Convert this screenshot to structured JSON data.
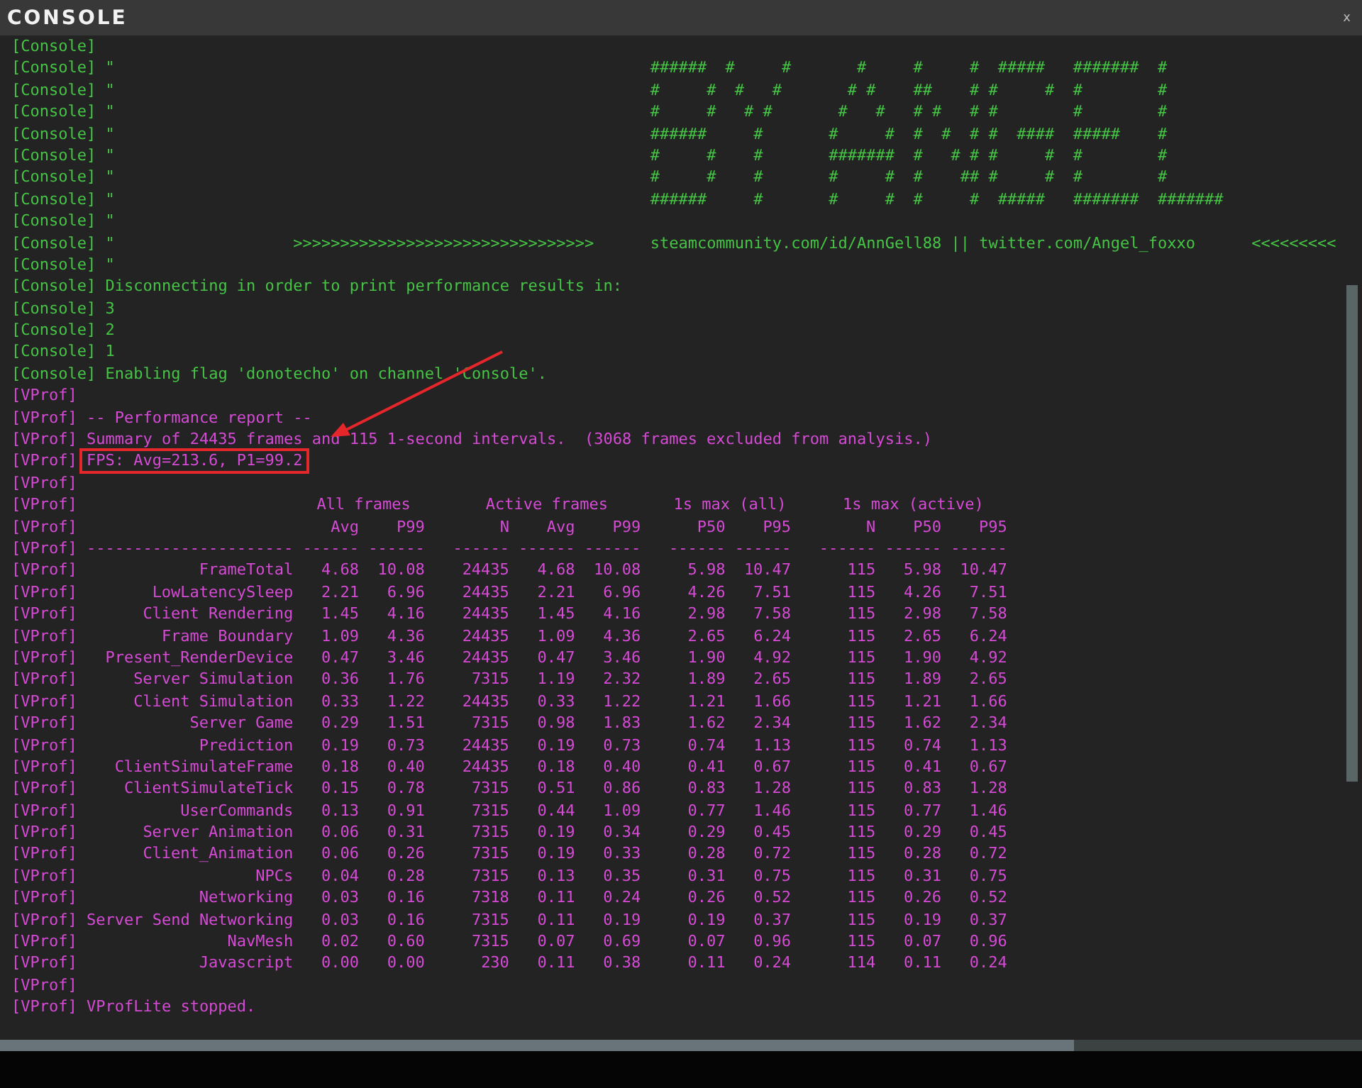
{
  "window": {
    "title": "CONSOLE",
    "close": "x"
  },
  "lines": [
    {
      "channel": "[Console]",
      "kind": "console"
    },
    {
      "channel": "[Console]",
      "kind": "console",
      "text": "\"                                                         ######  #     #       #     #     #  #####   #######  #",
      "highlighted": false
    },
    {
      "channel": "[Console]",
      "kind": "console",
      "text": "\"                                                         #     #  #   #       # #    ##    # #     #  #        #",
      "highlighted": false
    },
    {
      "channel": "[Console]",
      "kind": "console",
      "text": "\"                                                         #     #   # #       #   #   # #   # #        #        #",
      "highlighted": false
    },
    {
      "channel": "[Console]",
      "kind": "console",
      "text": "\"                                                         ######     #       #     #  #  #  # #  ####  #####    #",
      "highlighted": false
    },
    {
      "channel": "[Console]",
      "kind": "console",
      "text": "\"                                                         #     #    #       #######  #   # # #     #  #        #",
      "highlighted": false
    },
    {
      "channel": "[Console]",
      "kind": "console",
      "text": "\"                                                         #     #    #       #     #  #    ## #     #  #        #",
      "highlighted": false
    },
    {
      "channel": "[Console]",
      "kind": "console",
      "text": "\"                                                         ######     #       #     #  #     #  #####   #######  #######",
      "highlighted": false
    },
    {
      "channel": "[Console]",
      "kind": "console",
      "text": "\"",
      "highlighted": false
    },
    {
      "channel": "[Console]",
      "kind": "console",
      "text": "\"                   >>>>>>>>>>>>>>>>>>>>>>>>>>>>>>>>      steamcommunity.com/id/AnnGell88 || twitter.com/Angel_foxxo      <<<<<<<<<",
      "highlighted": false
    },
    {
      "channel": "[Console]",
      "kind": "console",
      "text": "\"",
      "highlighted": false
    },
    {
      "channel": "[Console]",
      "kind": "console",
      "text": "Disconnecting in order to print performance results in:",
      "highlighted": false
    },
    {
      "channel": "[Console]",
      "kind": "console",
      "text": "3",
      "highlighted": false
    },
    {
      "channel": "[Console]",
      "kind": "console",
      "text": "2",
      "highlighted": false
    },
    {
      "channel": "[Console]",
      "kind": "console",
      "text": "1",
      "highlighted": false
    },
    {
      "channel": "[Console]",
      "kind": "console",
      "text": "Enabling flag 'donotecho' on channel 'Console'.",
      "highlighted": false
    },
    {
      "channel": "[VProf]",
      "kind": "vprof"
    },
    {
      "channel": "[VProf]",
      "kind": "vprof",
      "text": "-- Performance report --",
      "highlighted": false
    },
    {
      "channel": "[VProf]",
      "kind": "vprof",
      "text": "Summary of 24435 frames and 115 1-second intervals.  (3068 frames excluded from analysis.)",
      "highlighted": false
    },
    {
      "channel": "[VProf]",
      "kind": "vprof",
      "text": "FPS: Avg=213.6, P1=99.2",
      "highlighted": true
    },
    {
      "channel": "[VProf]",
      "kind": "vprof"
    },
    {
      "channel": "[VProf]",
      "kind": "vprof",
      "groups": [
        "All frames",
        "Active frames",
        "1s max (all)",
        "1s max (active)"
      ]
    },
    {
      "channel": "[VProf]",
      "kind": "vprof",
      "columns": [
        "Avg",
        "P99",
        "N",
        "Avg",
        "P99",
        "P50",
        "P95",
        "N",
        "P50",
        "P95"
      ]
    },
    {
      "channel": "[VProf]",
      "kind": "vprof",
      "cells": [
        "----------------------",
        "------",
        "------",
        "------",
        "------",
        "------",
        "------",
        "------",
        "------",
        "------",
        "------"
      ]
    },
    {
      "channel": "[VProf]",
      "kind": "vprof",
      "cells": [
        "FrameTotal",
        "4.68",
        "10.08",
        "24435",
        "4.68",
        "10.08",
        "5.98",
        "10.47",
        "115",
        "5.98",
        "10.47"
      ]
    },
    {
      "channel": "[VProf]",
      "kind": "vprof",
      "cells": [
        "LowLatencySleep",
        "2.21",
        "6.96",
        "24435",
        "2.21",
        "6.96",
        "4.26",
        "7.51",
        "115",
        "4.26",
        "7.51"
      ]
    },
    {
      "channel": "[VProf]",
      "kind": "vprof",
      "cells": [
        "Client Rendering",
        "1.45",
        "4.16",
        "24435",
        "1.45",
        "4.16",
        "2.98",
        "7.58",
        "115",
        "2.98",
        "7.58"
      ]
    },
    {
      "channel": "[VProf]",
      "kind": "vprof",
      "cells": [
        "Frame Boundary",
        "1.09",
        "4.36",
        "24435",
        "1.09",
        "4.36",
        "2.65",
        "6.24",
        "115",
        "2.65",
        "6.24"
      ]
    },
    {
      "channel": "[VProf]",
      "kind": "vprof",
      "cells": [
        "Present_RenderDevice",
        "0.47",
        "3.46",
        "24435",
        "0.47",
        "3.46",
        "1.90",
        "4.92",
        "115",
        "1.90",
        "4.92"
      ]
    },
    {
      "channel": "[VProf]",
      "kind": "vprof",
      "cells": [
        "Server Simulation",
        "0.36",
        "1.76",
        "7315",
        "1.19",
        "2.32",
        "1.89",
        "2.65",
        "115",
        "1.89",
        "2.65"
      ]
    },
    {
      "channel": "[VProf]",
      "kind": "vprof",
      "cells": [
        "Client Simulation",
        "0.33",
        "1.22",
        "24435",
        "0.33",
        "1.22",
        "1.21",
        "1.66",
        "115",
        "1.21",
        "1.66"
      ]
    },
    {
      "channel": "[VProf]",
      "kind": "vprof",
      "cells": [
        "Server Game",
        "0.29",
        "1.51",
        "7315",
        "0.98",
        "1.83",
        "1.62",
        "2.34",
        "115",
        "1.62",
        "2.34"
      ]
    },
    {
      "channel": "[VProf]",
      "kind": "vprof",
      "cells": [
        "Prediction",
        "0.19",
        "0.73",
        "24435",
        "0.19",
        "0.73",
        "0.74",
        "1.13",
        "115",
        "0.74",
        "1.13"
      ]
    },
    {
      "channel": "[VProf]",
      "kind": "vprof",
      "cells": [
        "ClientSimulateFrame",
        "0.18",
        "0.40",
        "24435",
        "0.18",
        "0.40",
        "0.41",
        "0.67",
        "115",
        "0.41",
        "0.67"
      ]
    },
    {
      "channel": "[VProf]",
      "kind": "vprof",
      "cells": [
        "ClientSimulateTick",
        "0.15",
        "0.78",
        "7315",
        "0.51",
        "0.86",
        "0.83",
        "1.28",
        "115",
        "0.83",
        "1.28"
      ]
    },
    {
      "channel": "[VProf]",
      "kind": "vprof",
      "cells": [
        "UserCommands",
        "0.13",
        "0.91",
        "7315",
        "0.44",
        "1.09",
        "0.77",
        "1.46",
        "115",
        "0.77",
        "1.46"
      ]
    },
    {
      "channel": "[VProf]",
      "kind": "vprof",
      "cells": [
        "Server Animation",
        "0.06",
        "0.31",
        "7315",
        "0.19",
        "0.34",
        "0.29",
        "0.45",
        "115",
        "0.29",
        "0.45"
      ]
    },
    {
      "channel": "[VProf]",
      "kind": "vprof",
      "cells": [
        "Client_Animation",
        "0.06",
        "0.26",
        "7315",
        "0.19",
        "0.33",
        "0.28",
        "0.72",
        "115",
        "0.28",
        "0.72"
      ]
    },
    {
      "channel": "[VProf]",
      "kind": "vprof",
      "cells": [
        "NPCs",
        "0.04",
        "0.28",
        "7315",
        "0.13",
        "0.35",
        "0.31",
        "0.75",
        "115",
        "0.31",
        "0.75"
      ]
    },
    {
      "channel": "[VProf]",
      "kind": "vprof",
      "cells": [
        "Networking",
        "0.03",
        "0.16",
        "7318",
        "0.11",
        "0.24",
        "0.26",
        "0.52",
        "115",
        "0.26",
        "0.52"
      ]
    },
    {
      "channel": "[VProf]",
      "kind": "vprof",
      "cells": [
        "Server Send Networking",
        "0.03",
        "0.16",
        "7315",
        "0.11",
        "0.19",
        "0.19",
        "0.37",
        "115",
        "0.19",
        "0.37"
      ]
    },
    {
      "channel": "[VProf]",
      "kind": "vprof",
      "cells": [
        "NavMesh",
        "0.02",
        "0.60",
        "7315",
        "0.07",
        "0.69",
        "0.07",
        "0.96",
        "115",
        "0.07",
        "0.96"
      ]
    },
    {
      "channel": "[VProf]",
      "kind": "vprof",
      "cells": [
        "Javascript",
        "0.00",
        "0.00",
        "230",
        "0.11",
        "0.38",
        "0.11",
        "0.24",
        "114",
        "0.11",
        "0.24"
      ]
    },
    {
      "channel": "[VProf]",
      "kind": "vprof"
    },
    {
      "channel": "[VProf]",
      "kind": "vprof",
      "text": "VProfLite stopped.",
      "highlighted": false
    }
  ]
}
